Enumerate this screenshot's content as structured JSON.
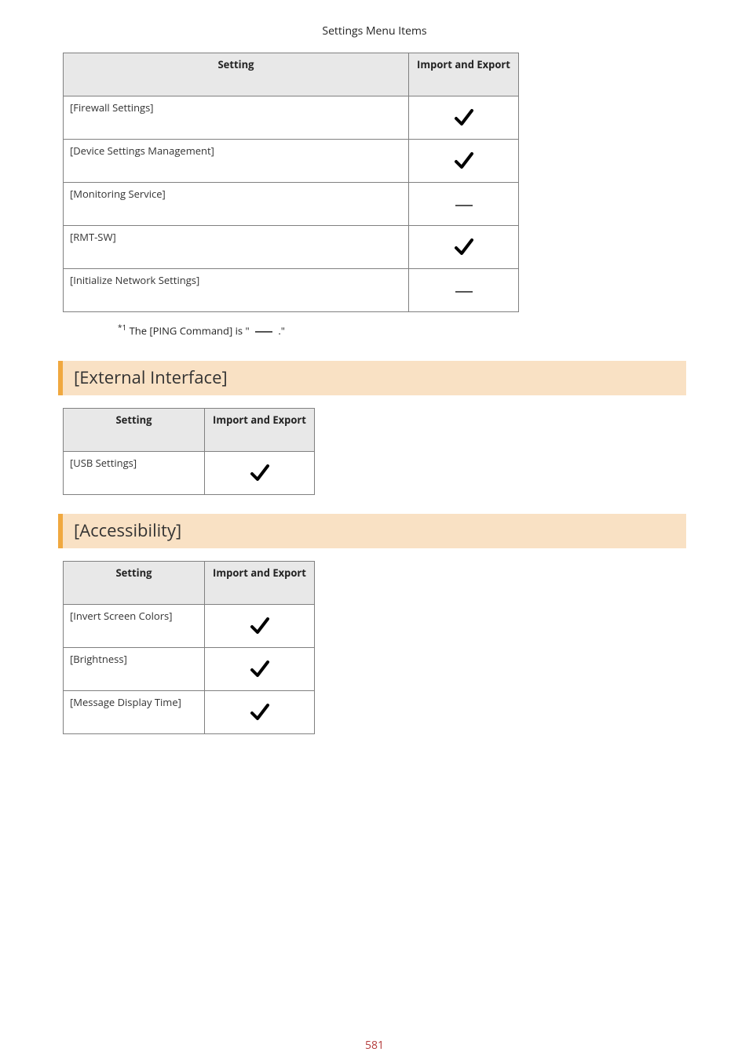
{
  "page_title": "Settings Menu Items",
  "page_number": "581",
  "columns": {
    "setting": "Setting",
    "status": "Import and Export"
  },
  "icons": {
    "check": "check",
    "dash": "dash"
  },
  "table1": {
    "rows": [
      {
        "label": "[Firewall Settings]",
        "status": "check"
      },
      {
        "label": "[Device Settings Management]",
        "status": "check"
      },
      {
        "label": "[Monitoring Service]",
        "status": "dash"
      },
      {
        "label": "[RMT-SW]",
        "status": "check"
      },
      {
        "label": "[Initialize Network Settings]",
        "status": "dash"
      }
    ]
  },
  "footnote": {
    "marker": "*1",
    "before": " The [PING Command] is \" ",
    "after": " .\""
  },
  "section2": {
    "heading": "[External Interface]"
  },
  "table2": {
    "rows": [
      {
        "label": "[USB Settings]",
        "status": "check"
      }
    ]
  },
  "section3": {
    "heading": "[Accessibility]"
  },
  "table3": {
    "rows": [
      {
        "label": "[Invert Screen Colors]",
        "status": "check"
      },
      {
        "label": "[Brightness]",
        "status": "check"
      },
      {
        "label": "[Message Display Time]",
        "status": "check"
      }
    ]
  }
}
